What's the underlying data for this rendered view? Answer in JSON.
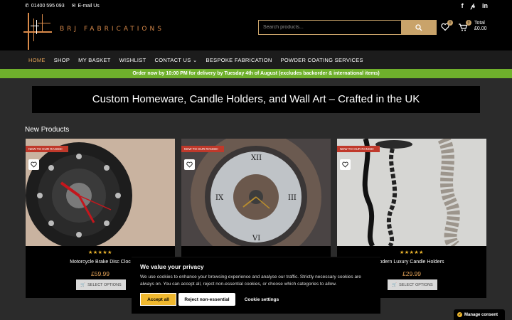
{
  "topbar": {
    "phone": "01400 595 093",
    "email_label": "E-mail Us",
    "social": [
      "facebook",
      "pinterest",
      "linkedin"
    ]
  },
  "header": {
    "brand": "BRJ FABRICATIONS",
    "search_placeholder": "Search products...",
    "wishlist_count": "0",
    "cart_count": "0",
    "total_label": "Total",
    "total_value": "£0.00"
  },
  "nav": {
    "items": [
      "HOME",
      "SHOP",
      "MY BASKET",
      "WISHLIST",
      "CONTACT US ⌄",
      "BESPOKE FABRICATION",
      "POWDER COATING SERVICES"
    ]
  },
  "delivery_banner": "Order now by 10:00 PM for delivery by Tuesday 4th of August (excludes backorder & international items)",
  "hero_title": "Custom Homeware, Candle Holders, and Wall Art – Crafted in the UK",
  "section_title": "New Products",
  "products": [
    {
      "tag": "NEW TO OUR RANGE!",
      "name": "Motorcycle Brake Disc Cloc",
      "price": "£59.99",
      "option": "SELECT OPTIONS",
      "stars": "★★★★★"
    },
    {
      "tag": "NEW TO OUR RANGE!",
      "name": "",
      "price": "",
      "option": "",
      "stars": ""
    },
    {
      "tag": "NEW TO OUR RANGE!",
      "name": "odern Luxury Candle Holders",
      "price": "£29.99",
      "option": "SELECT OPTIONS",
      "stars": "★★★★★"
    }
  ],
  "cookie": {
    "title": "We value your privacy",
    "body": "We use cookies to enhance your browsing experience and analyse our traffic. Strictly necessary cookies are always on. You can accept all, reject non-essential cookies, or choose which categories to allow.",
    "accept": "Accept all",
    "reject": "Reject non-essential",
    "settings": "Cookie settings"
  },
  "manage_consent": "Manage consent",
  "colors": {
    "accent": "#c9a36a",
    "nav_active": "#e3a257",
    "banner": "#6fb02c",
    "stars": "#f0b82e"
  }
}
